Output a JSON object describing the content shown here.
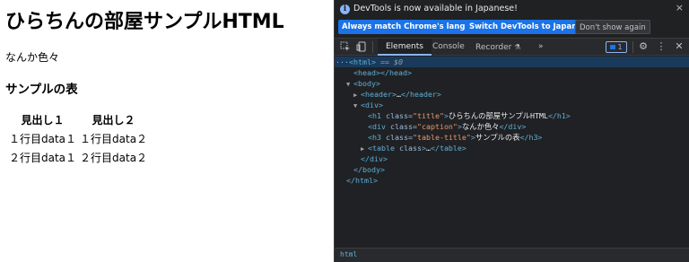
{
  "page": {
    "title": "ひらちんの部屋サンプルHTML",
    "caption": "なんか色々",
    "table_title": "サンプルの表",
    "table": {
      "headers": [
        "見出し１",
        "見出し２"
      ],
      "rows": [
        [
          "１行目data１",
          "１行目data２"
        ],
        [
          "２行目data１",
          "２行目data２"
        ]
      ]
    }
  },
  "devtools": {
    "infobar": {
      "message": "DevTools is now available in Japanese!",
      "buttons": {
        "match_language": "Always match Chrome's language",
        "switch_japanese": "Switch DevTools to Japanese",
        "dont_show": "Don't show again"
      }
    },
    "tabs": {
      "elements": "Elements",
      "console": "Console",
      "recorder": "Recorder",
      "more": "»"
    },
    "issues_count": "1",
    "dom": {
      "l1": {
        "prefix": "···",
        "open": "<html>",
        "eq": "== $0"
      },
      "l2": {
        "text": "<head></head>"
      },
      "l3": {
        "text": "<body>"
      },
      "l4": {
        "open": "<header>",
        "ellipsis": "…",
        "close": "</header>"
      },
      "l5": {
        "text": "<div>"
      },
      "l6": {
        "open_tag": "<h1 ",
        "attr": "class=",
        "val": "\"title\"",
        "close_bracket": ">",
        "content": "ひらちんの部屋サンプルHTML",
        "end": "</h1>"
      },
      "l7": {
        "open_tag": "<div ",
        "attr": "class=",
        "val": "\"caption\"",
        "close_bracket": ">",
        "content": "なんか色々",
        "end": "</div>"
      },
      "l8": {
        "open_tag": "<h3 ",
        "attr": "class=",
        "val": "\"table-title\"",
        "close_bracket": ">",
        "content": "サンプルの表",
        "end": "</h3>"
      },
      "l9": {
        "open_tag": "<table ",
        "attr": "class",
        "close_bracket": ">",
        "ellipsis": "…",
        "end": "</table>"
      },
      "l10": {
        "text": "</div>"
      },
      "l11": {
        "text": "</body>"
      },
      "l12": {
        "text": "</html>"
      }
    },
    "breadcrumb": "html"
  }
}
